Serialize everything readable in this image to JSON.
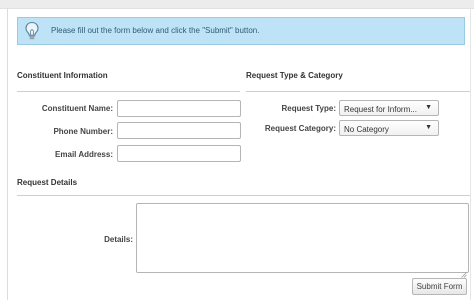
{
  "notice": {
    "text": "Please fill out the form below and click the \"Submit\" button.",
    "icon": "lightbulb-icon"
  },
  "constituent": {
    "title": "Constituent Information",
    "name_label": "Constituent Name:",
    "name_value": "",
    "phone_label": "Phone Number:",
    "phone_value": "",
    "email_label": "Email Address:",
    "email_value": ""
  },
  "request_type": {
    "title": "Request Type & Category",
    "type_label": "Request Type:",
    "type_value": "Request for Inform...",
    "category_label": "Request Category:",
    "category_value": "No Category"
  },
  "details": {
    "title": "Request Details",
    "details_label": "Details:",
    "details_value": ""
  },
  "actions": {
    "submit_label": "Submit Form"
  },
  "colors": {
    "notice_bg": "#bfe3f6",
    "notice_border": "#9cc9e3",
    "notice_text": "#2d5b78"
  }
}
